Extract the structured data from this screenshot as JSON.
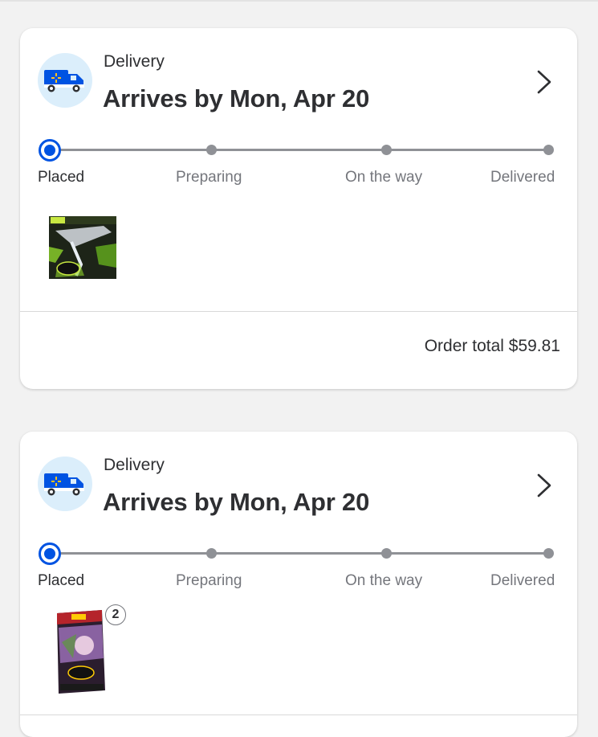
{
  "orders": [
    {
      "delivery_type": "Delivery",
      "arrival": "Arrives by Mon, Apr 20",
      "steps": [
        "Placed",
        "Preparing",
        "On the way",
        "Delivered"
      ],
      "current_step": 0,
      "item_image": "Pokemon Elite Trainer Box - Perfect Order",
      "order_total": "Order total $59.81"
    },
    {
      "delivery_type": "Delivery",
      "arrival": "Arrives by Mon, Apr 20",
      "steps": [
        "Placed",
        "Preparing",
        "On the way",
        "Delivered"
      ],
      "current_step": 0,
      "item_image": "Pokemon booster bundle - Perfect Order",
      "quantity": "2"
    }
  ],
  "colors": {
    "accent": "#0053e2",
    "truck_bg": "#dbeefb",
    "track": "#8f9196"
  },
  "icons": [
    "delivery-truck-icon",
    "chevron-right-icon"
  ]
}
